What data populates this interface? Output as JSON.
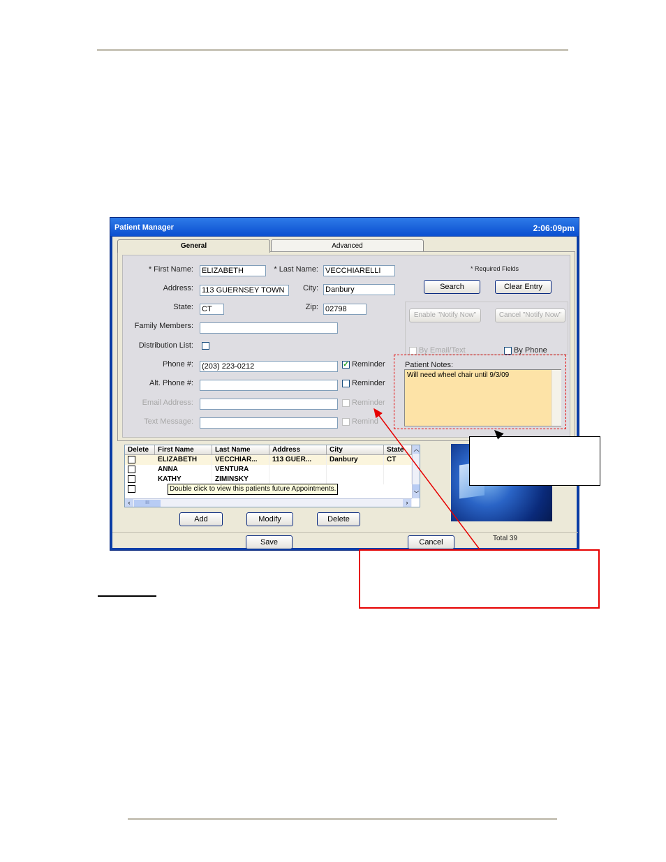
{
  "window": {
    "title": "Patient Manager",
    "clock": "2:06:09pm"
  },
  "tabs": [
    "General",
    "Advanced"
  ],
  "form": {
    "first_name_label": "* First Name:",
    "first_name_value": "ELIZABETH",
    "last_name_label": "* Last Name:",
    "last_name_value": "VECCHIARELLI",
    "address_label": "Address:",
    "address_value": "113 GUERNSEY TOWN",
    "city_label": "City:",
    "city_value": "Danbury",
    "state_label": "State:",
    "state_value": "CT",
    "zip_label": "Zip:",
    "zip_value": "02798",
    "family_label": "Family Members:",
    "family_value": "",
    "distribution_label": "Distribution List:",
    "phone_label": "Phone #:",
    "phone_value": "(203) 223-0212",
    "alt_phone_label": "Alt. Phone #:",
    "alt_phone_value": "",
    "email_label": "Email Address:",
    "email_value": "",
    "text_label": "Text Message:",
    "text_value": "",
    "reminder_label": "Reminder",
    "reminder_short": "Remind",
    "required_note": "* Required Fields"
  },
  "buttons": {
    "search": "Search",
    "clear": "Clear Entry",
    "enable_notify": "Enable \"Notify Now\"",
    "cancel_notify": "Cancel \"Notify Now\"",
    "add": "Add",
    "modify": "Modify",
    "delete": "Delete",
    "save": "Save",
    "cancel": "Cancel"
  },
  "notify": {
    "by_email": "By Email/Text",
    "by_phone": "By Phone"
  },
  "notes": {
    "label": "Patient Notes:",
    "value": "Will need wheel chair until 9/3/09"
  },
  "grid": {
    "headers": [
      "Delete",
      "First Name",
      "Last Name",
      "Address",
      "City",
      "State"
    ],
    "rows": [
      [
        "ELIZABETH",
        "VECCHIAR...",
        "113 GUER...",
        "Danbury",
        "CT"
      ],
      [
        "ANNA",
        "VENTURA",
        "",
        "",
        ""
      ],
      [
        "KATHY",
        "ZIMINSKY",
        "",
        "",
        ""
      ]
    ],
    "tooltip": "Double click to view this patients future Appointments.",
    "scroll_thumb": "III"
  },
  "total": "Total 39",
  "colors": {
    "callout_red": "#e60000",
    "notes_bg": "#fde3a7",
    "titlebar": "#0b4fd0"
  }
}
